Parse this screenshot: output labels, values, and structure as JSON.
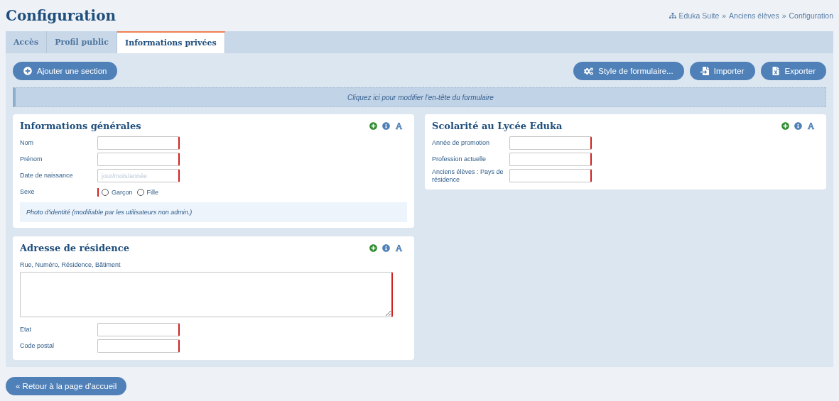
{
  "page": {
    "title": "Configuration"
  },
  "breadcrumb": [
    "Eduka Suite",
    "»",
    "Anciens élèves",
    "»",
    "Configuration"
  ],
  "tabs": [
    {
      "label": "Accès",
      "selected": false
    },
    {
      "label": "Profil public",
      "selected": false
    },
    {
      "label": "Informations privées",
      "selected": true
    }
  ],
  "toolbar": {
    "add_button": "Ajouter une section",
    "right_buttons": [
      {
        "label": "Style de formulaire...",
        "kind": "gears"
      },
      {
        "label": "Importer",
        "kind": "import"
      },
      {
        "label": "Exporter",
        "kind": "excel"
      }
    ]
  },
  "form_header": "Cliquez ici pour modifier l'en-tête du formulaire",
  "columns": [
    {
      "sections": [
        {
          "title": "Informations générales",
          "fields": [
            {
              "kind": "text",
              "label": "Nom",
              "required": true
            },
            {
              "kind": "text",
              "label": "Prénom",
              "required": true
            },
            {
              "kind": "text",
              "label": "Date de naissance",
              "placeholder": "jour/mois/année",
              "required": true
            },
            {
              "kind": "radio",
              "label": "Sexe",
              "required": true,
              "options": [
                {
                  "label": "Garçon",
                  "selected": false
                },
                {
                  "label": "Fille",
                  "selected": false
                }
              ]
            },
            {
              "kind": "note",
              "label": "Photo d'identité (modifiable par les utilisateurs non admin.)"
            }
          ]
        },
        {
          "title": "Adresse de résidence",
          "fields": [
            {
              "kind": "textarea",
              "label": "Rue, Numéro, Résidence, Bâtiment",
              "required": true
            },
            {
              "kind": "text",
              "label": "Etat",
              "required": true
            },
            {
              "kind": "text",
              "label": "Code postal",
              "required": true
            }
          ]
        }
      ]
    },
    {
      "sections": [
        {
          "title": "Scolarité au Lycée Eduka",
          "fields": [
            {
              "kind": "text",
              "label": "Année de promotion",
              "required": true
            },
            {
              "kind": "text",
              "label": "Profession actuelle",
              "required": true
            },
            {
              "kind": "text",
              "label": "Anciens élèves : Pays de résidence",
              "required": true
            }
          ]
        }
      ]
    }
  ],
  "back_button": "« Retour à la page d'accueil"
}
